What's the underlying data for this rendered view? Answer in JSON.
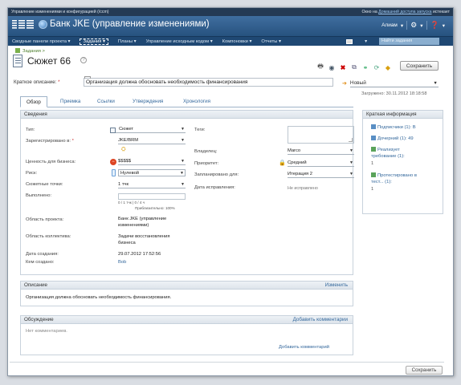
{
  "topbar": {
    "app": "Управление изменениями и конфигурацией (/ccm)",
    "right_prefix": "Окно на",
    "right_link": "Домашний доступа запуска",
    "right_suffix": "истекает"
  },
  "header": {
    "project_title": "Банк JKE (управление изменениями)",
    "user": "Алиам"
  },
  "nav": {
    "items": [
      "Сводные панели проекта ▾",
      "Задания ▾",
      "Планы ▾",
      "Управление исходным кодом ▾",
      "Компоновки ▾",
      "Отчеты ▾"
    ],
    "active_index": 1,
    "search_placeholder": "Найти задания"
  },
  "breadcrumb": "Задания >",
  "work_item": {
    "title": "Сюжет 66",
    "save_label": "Сохранить",
    "summary_label": "Краткое описание:",
    "summary_value": "Организация должна обосновать необходимость финансирования",
    "state": "Новый",
    "loaded": "Загружено: 30.11.2012 18:18:58"
  },
  "tabs": [
    "Обзор",
    "Приемка",
    "Ссылки",
    "Утверждения",
    "Хронология"
  ],
  "details": {
    "header": "Сведения",
    "type_label": "Тип:",
    "type_value": "Сюжет",
    "filed_label": "Зарегистрировано в:",
    "filed_value": "JKE/BRM",
    "business_value_label": "Ценность для бизнеса:",
    "business_value": "$$$$$",
    "risk_label": "Риск:",
    "risk_value": "Нулевой",
    "story_points_label": "Сюжетные точки:",
    "story_points_value": "1 тчк",
    "done_label": "Выполнено:",
    "progress_text": "0 / 1 тчк | 0 / 4 ч",
    "estimate_text": "Приблизительно: 100%",
    "project_area_label": "Область проекта:",
    "project_area_value": "Банк JKE (управление изменениями)",
    "team_area_label": "Область коллектива:",
    "team_area_value": "Задачи восстановления бизнеса",
    "created_date_label": "Дата создания:",
    "created_date_value": "29.07.2012 17:52:56",
    "created_by_label": "Кем создано:",
    "created_by_value": "Bob",
    "tags_label": "Теги:",
    "owner_label": "Владелец:",
    "owner_value": "Marco",
    "priority_label": "Приоритет:",
    "priority_value": "Средний",
    "planned_for_label": "Запланировано для:",
    "planned_for_value": "Итерация 2",
    "resolution_date_label": "Дата исправления:",
    "resolution_date_value": "Не исправлено"
  },
  "quick_info": {
    "header": "Краткая информация",
    "subscribers": "Подписчики (1): В",
    "children": "Дочерний (1): 49",
    "implements_1": "Реализует",
    "implements_2": "требование (1):",
    "implements_count": "1",
    "tested_1": "Протестировано в",
    "tested_2": "тест... (1):",
    "tested_count": "1"
  },
  "description": {
    "header": "Описание",
    "edit": "Изменить",
    "text": "Организация должна обосновать необходимость финансирования."
  },
  "discussion": {
    "header": "Обсуждение",
    "add_top": "Добавить комментарии",
    "empty": "Нет комментариев.",
    "add_bottom": "Добавить комментарий"
  },
  "footer": {
    "save_label": "Сохранить"
  },
  "colors": {
    "header_blue": "#27527f",
    "nav_blue": "#1f4873",
    "link_blue": "#34689c"
  }
}
